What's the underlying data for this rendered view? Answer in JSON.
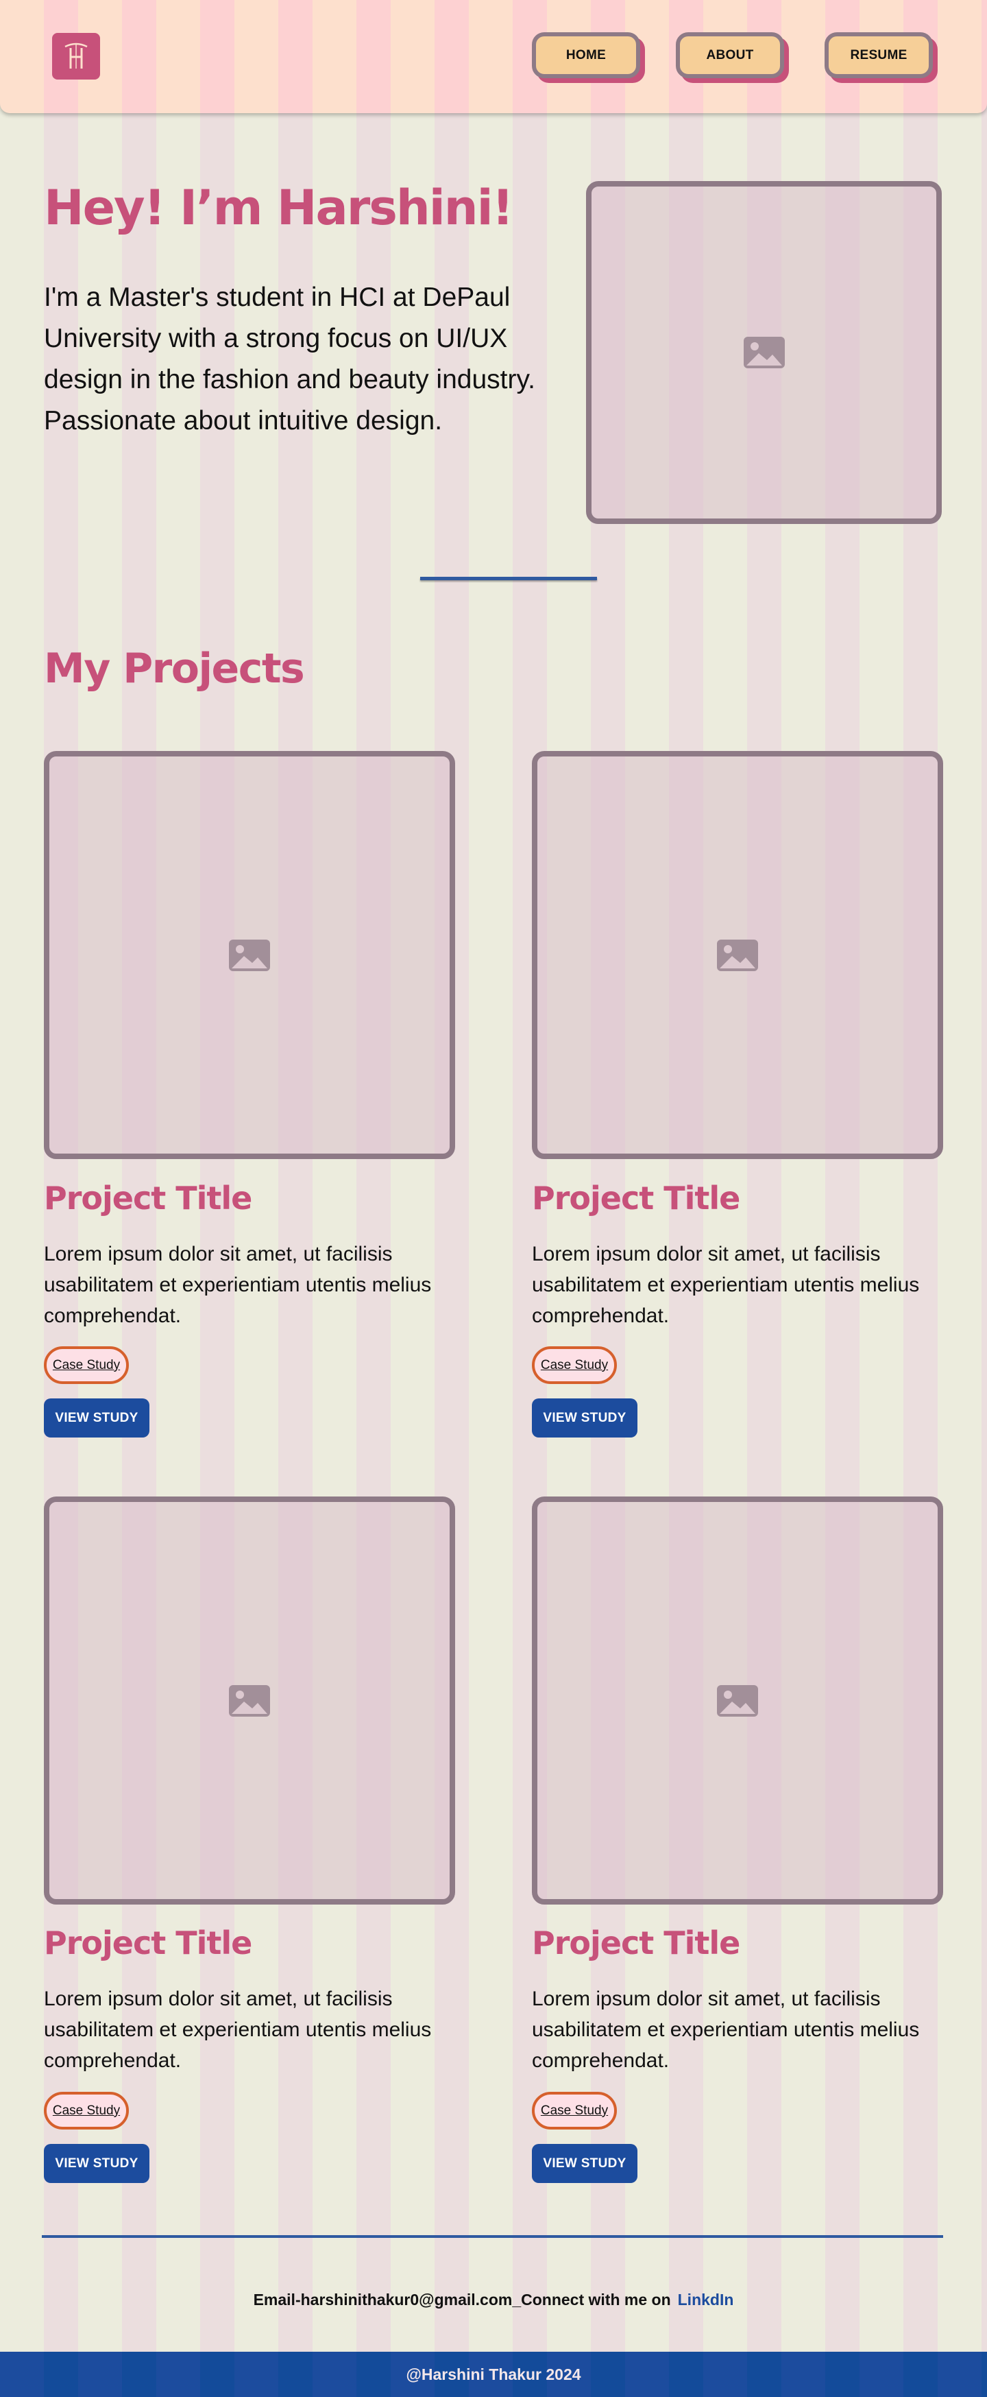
{
  "header": {
    "logo_text": "H",
    "nav": [
      {
        "label": "HOME"
      },
      {
        "label": "ABOUT"
      },
      {
        "label": "RESUME"
      }
    ]
  },
  "hero": {
    "title": "Hey! I’m Harshini!",
    "description": "I'm a Master's student in HCI at DePaul University with a strong focus on UI/UX design in the fashion and beauty industry. Passionate about intuitive design.",
    "image_icon": "image-placeholder-icon"
  },
  "projects_section": {
    "title": "My Projects",
    "projects": [
      {
        "title": "Project Title",
        "description": "Lorem ipsum dolor sit amet, ut facilisis usabilitatem et experientiam utentis melius comprehendat.",
        "tag": "Case Study",
        "button": "VIEW STUDY"
      },
      {
        "title": "Project Title",
        "description": "Lorem ipsum dolor sit amet, ut facilisis usabilitatem et experientiam utentis melius comprehendat.",
        "tag": "Case Study",
        "button": "VIEW STUDY"
      },
      {
        "title": "Project Title",
        "description": "Lorem ipsum dolor sit amet, ut facilisis usabilitatem et experientiam utentis melius comprehendat.",
        "tag": "Case Study",
        "button": "VIEW STUDY"
      },
      {
        "title": "Project Title",
        "description": "Lorem ipsum dolor sit amet, ut facilisis usabilitatem et experientiam utentis melius comprehendat.",
        "tag": "Case Study",
        "button": "VIEW STUDY"
      }
    ]
  },
  "footer": {
    "contact_text": "Email-harshinithakur0@gmail.com_Connect with me on",
    "link_label": "LinkdIn",
    "copyright": "@Harshini Thakur 2024"
  },
  "colors": {
    "accent_pink": "#c7517a",
    "brand_blue": "#1c4c9e",
    "nav_button_fill": "#f6cf98",
    "tag_border": "#d6602c"
  }
}
